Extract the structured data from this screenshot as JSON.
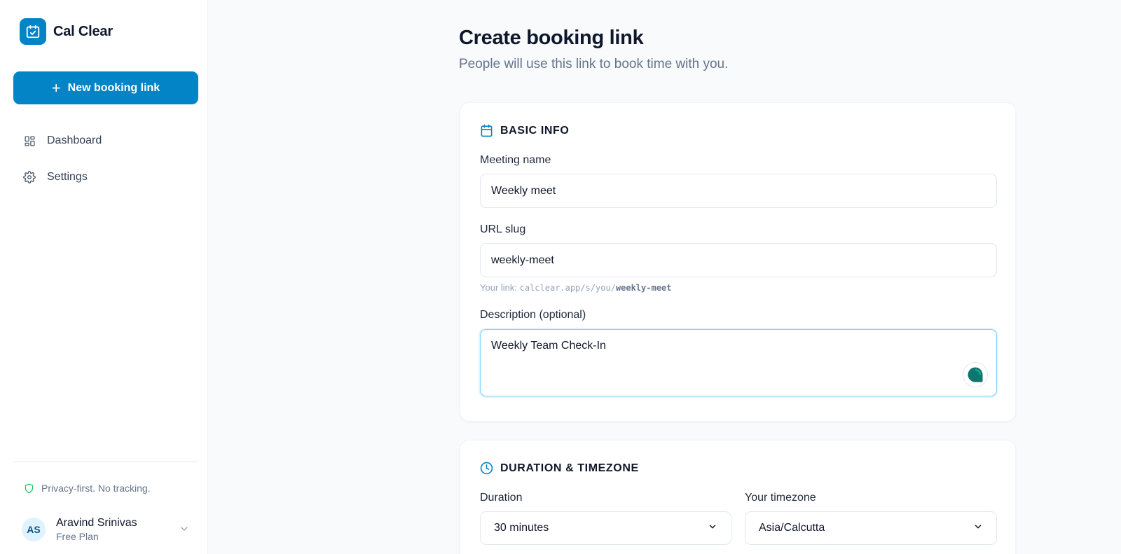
{
  "app": {
    "name": "Cal Clear",
    "logo_icon": "calendar-check-icon",
    "brand_color": "#0284c7"
  },
  "sidebar": {
    "new_button_label": "New booking link",
    "nav": [
      {
        "label": "Dashboard",
        "icon": "grid-icon"
      },
      {
        "label": "Settings",
        "icon": "gear-icon"
      }
    ],
    "privacy_text": "Privacy-first. No tracking.",
    "user": {
      "initials": "AS",
      "name": "Aravind Srinivas",
      "plan": "Free Plan"
    }
  },
  "page": {
    "title": "Create booking link",
    "subtitle": "People will use this link to book time with you."
  },
  "basic_info": {
    "heading": "BASIC INFO",
    "meeting_name_label": "Meeting name",
    "meeting_name_value": "Weekly meet",
    "slug_label": "URL slug",
    "slug_value": "weekly-meet",
    "link_prefix": "Your link:",
    "link_base": "calclear.app/s/you/",
    "link_slug": "weekly-meet",
    "description_label": "Description (optional)",
    "description_value": "Weekly Team Check-In"
  },
  "duration_timezone": {
    "heading": "DURATION & TIMEZONE",
    "duration_label": "Duration",
    "duration_value": "30 minutes",
    "timezone_label": "Your timezone",
    "timezone_value": "Asia/Calcutta"
  }
}
